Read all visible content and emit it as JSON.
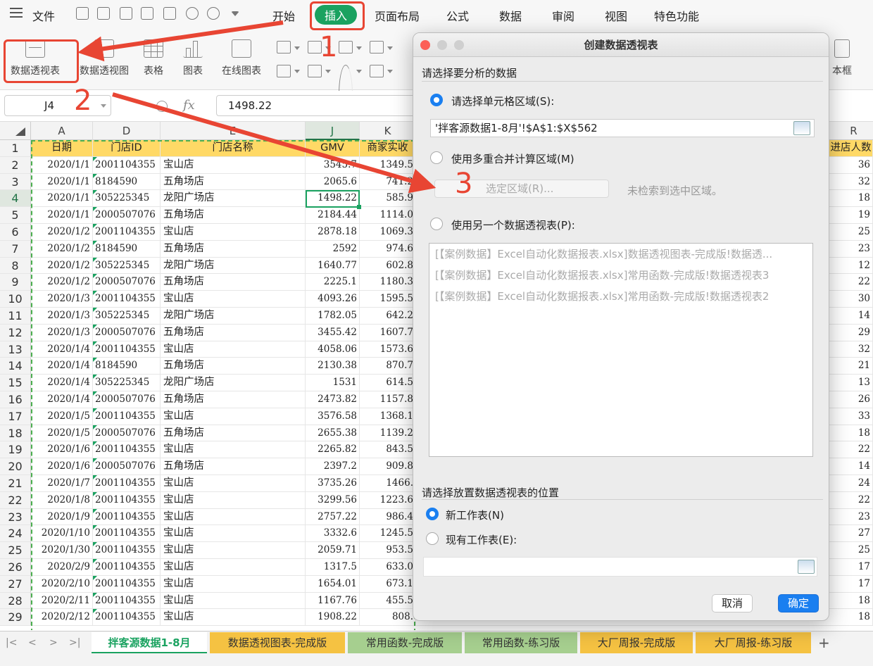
{
  "menubar": {
    "file": "文件",
    "tabs": [
      "开始",
      "插入",
      "页面布局",
      "公式",
      "数据",
      "审阅",
      "视图",
      "特色功能"
    ],
    "active_tab": "插入"
  },
  "ribbon": {
    "pivot_table": "数据透视表",
    "pivot_chart": "数据透视图",
    "table": "表格",
    "chart": "图表",
    "online_chart": "在线图表",
    "textbox_partial": "本框"
  },
  "formula_bar": {
    "name_box": "J4",
    "fx": "fx",
    "value": "1498.22"
  },
  "grid": {
    "col_letters": [
      "A",
      "D",
      "E",
      "J",
      "K",
      "R"
    ],
    "header_row": [
      "日期",
      "门店ID",
      "门店名称",
      "GMV",
      "商家实收",
      "进店人数"
    ],
    "rows": [
      [
        "2020/1/1",
        "2001104355",
        "宝山店",
        "3545.7",
        "1349.5",
        "36"
      ],
      [
        "2020/1/1",
        "8184590",
        "五角场店",
        "2065.6",
        "741.2",
        "32"
      ],
      [
        "2020/1/1",
        "305225345",
        "龙阳广场店",
        "1498.22",
        "585.9",
        "18"
      ],
      [
        "2020/1/1",
        "2000507076",
        "五角场店",
        "2184.44",
        "1114.0",
        "19"
      ],
      [
        "2020/1/2",
        "2001104355",
        "宝山店",
        "2878.18",
        "1069.3",
        "25"
      ],
      [
        "2020/1/2",
        "8184590",
        "五角场店",
        "2592",
        "974.6",
        "23"
      ],
      [
        "2020/1/2",
        "305225345",
        "龙阳广场店",
        "1640.77",
        "602.8",
        "12"
      ],
      [
        "2020/1/2",
        "2000507076",
        "五角场店",
        "2225.1",
        "1180.3",
        "22"
      ],
      [
        "2020/1/3",
        "2001104355",
        "宝山店",
        "4093.26",
        "1595.5",
        "30"
      ],
      [
        "2020/1/3",
        "305225345",
        "龙阳广场店",
        "1782.05",
        "642.2",
        "14"
      ],
      [
        "2020/1/3",
        "2000507076",
        "五角场店",
        "3455.42",
        "1607.7",
        "29"
      ],
      [
        "2020/1/4",
        "2001104355",
        "宝山店",
        "4058.06",
        "1573.6",
        "32"
      ],
      [
        "2020/1/4",
        "8184590",
        "五角场店",
        "2130.38",
        "870.7",
        "21"
      ],
      [
        "2020/1/4",
        "305225345",
        "龙阳广场店",
        "1531",
        "614.5",
        "13"
      ],
      [
        "2020/1/4",
        "2000507076",
        "五角场店",
        "2473.82",
        "1157.8",
        "26"
      ],
      [
        "2020/1/5",
        "2001104355",
        "宝山店",
        "3576.58",
        "1368.1",
        "33"
      ],
      [
        "2020/1/5",
        "2000507076",
        "五角场店",
        "2655.38",
        "1139.2",
        "18"
      ],
      [
        "2020/1/6",
        "2001104355",
        "宝山店",
        "2265.82",
        "843.5",
        "22"
      ],
      [
        "2020/1/6",
        "2000507076",
        "五角场店",
        "2397.2",
        "909.8",
        "14"
      ],
      [
        "2020/1/7",
        "2001104355",
        "宝山店",
        "3735.26",
        "1466.",
        "24"
      ],
      [
        "2020/1/8",
        "2001104355",
        "宝山店",
        "3299.56",
        "1223.6",
        "22"
      ],
      [
        "2020/1/9",
        "2001104355",
        "宝山店",
        "2757.22",
        "986.4",
        "23"
      ],
      [
        "2020/1/10",
        "2001104355",
        "宝山店",
        "3332.6",
        "1245.5",
        "27"
      ],
      [
        "2020/1/30",
        "2001104355",
        "宝山店",
        "2059.71",
        "953.5",
        "25"
      ],
      [
        "2020/2/9",
        "2001104355",
        "宝山店",
        "1317.5",
        "633.0",
        "17"
      ],
      [
        "2020/2/10",
        "2001104355",
        "宝山店",
        "1654.01",
        "673.1",
        "17"
      ],
      [
        "2020/2/11",
        "2001104355",
        "宝山店",
        "1167.76",
        "455.5",
        "18"
      ],
      [
        "2020/2/12",
        "2001104355",
        "宝山店",
        "1908.22",
        "808.",
        "18"
      ]
    ]
  },
  "sheets": [
    "拌客源数据1-8月",
    "数据透视图表-完成版",
    "常用函数-完成版",
    "常用函数-练习版",
    "大厂周报-完成版",
    "大厂周报-练习版"
  ],
  "dialog": {
    "title": "创建数据透视表",
    "section1": "请选择要分析的数据",
    "opt_range": "请选择单元格区域(S):",
    "range_value": "'拌客源数据1-8月'!$A$1:$X$562",
    "opt_multi": "使用多重合并计算区域(M)",
    "pick_range": "选定区域(R)...",
    "pick_hint": "未检索到选中区域。",
    "opt_other": "使用另一个数据透视表(P):",
    "pivot_list": [
      "[【案例数据】Excel自动化数据报表.xlsx]数据透视图表-完成版!数据透...",
      "[【案例数据】Excel自动化数据报表.xlsx]常用函数-完成版!数据透视表3",
      "[【案例数据】Excel自动化数据报表.xlsx]常用函数-完成版!数据透视表2"
    ],
    "section2": "请选择放置数据透视表的位置",
    "opt_new": "新工作表(N)",
    "opt_existing": "现有工作表(E):",
    "cancel": "取消",
    "ok": "确定"
  },
  "annotations": [
    "1",
    "2",
    "3"
  ]
}
